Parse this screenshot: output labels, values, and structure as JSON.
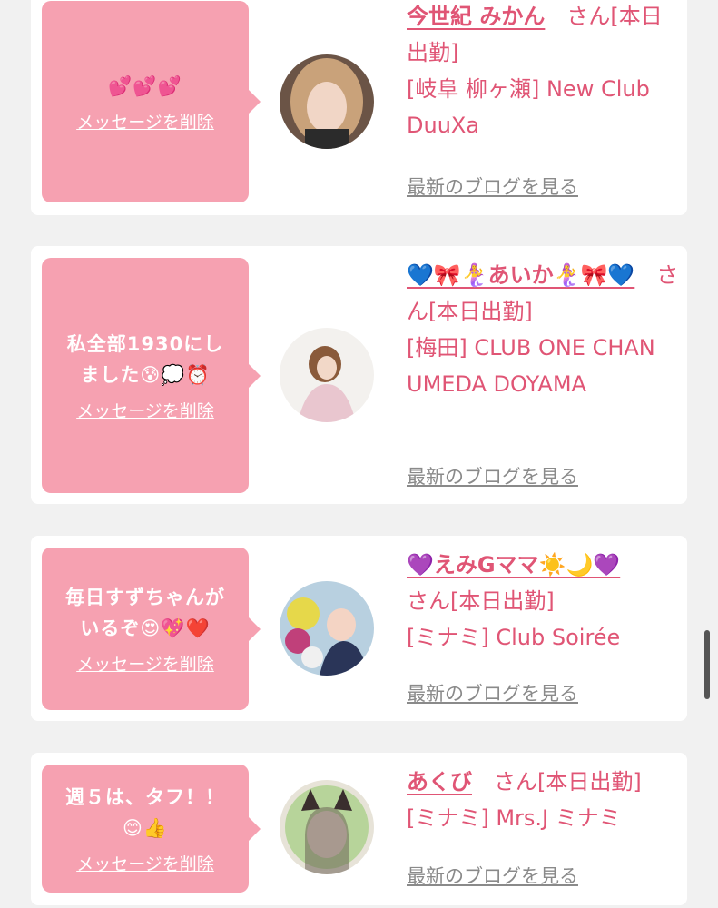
{
  "cards": [
    {
      "message_line1": "💕💕💕",
      "message_line2": "",
      "delete_label": "メッセージを削除",
      "name": "今世紀 みかん",
      "name_suffix": "　さん[本日出勤]",
      "shop": "[岐阜 柳ヶ瀬] New Club DuuXa",
      "blog_label": "最新のブログを見る"
    },
    {
      "message_line1": "私全部1930にし",
      "message_line2": "ました😰💭⏰",
      "delete_label": "メッセージを削除",
      "name": "💙🎀🧜‍♀️あいか🧜‍♀️🎀💙",
      "name_suffix": "　さん[本日出勤]",
      "shop": "[梅田] CLUB ONE CHAN UMEDA DOYAMA",
      "blog_label": "最新のブログを見る"
    },
    {
      "message_line1": "毎日すずちゃんが",
      "message_line2": "いるぞ😍💖❤️",
      "delete_label": "メッセージを削除",
      "name": "💜えみGママ☀️🌙💜",
      "name_suffix": "さん[本日出勤]",
      "shop": "[ミナミ] Club Soirée",
      "blog_label": "最新のブログを見る"
    },
    {
      "message_line1": "週５は、タフ！！",
      "message_line2": "😊👍",
      "delete_label": "メッセージを削除",
      "name": "あくび",
      "name_suffix": "　さん[本日出勤]",
      "shop": "[ミナミ] Mrs.J ミナミ",
      "blog_label": "最新のブログを見る"
    }
  ]
}
